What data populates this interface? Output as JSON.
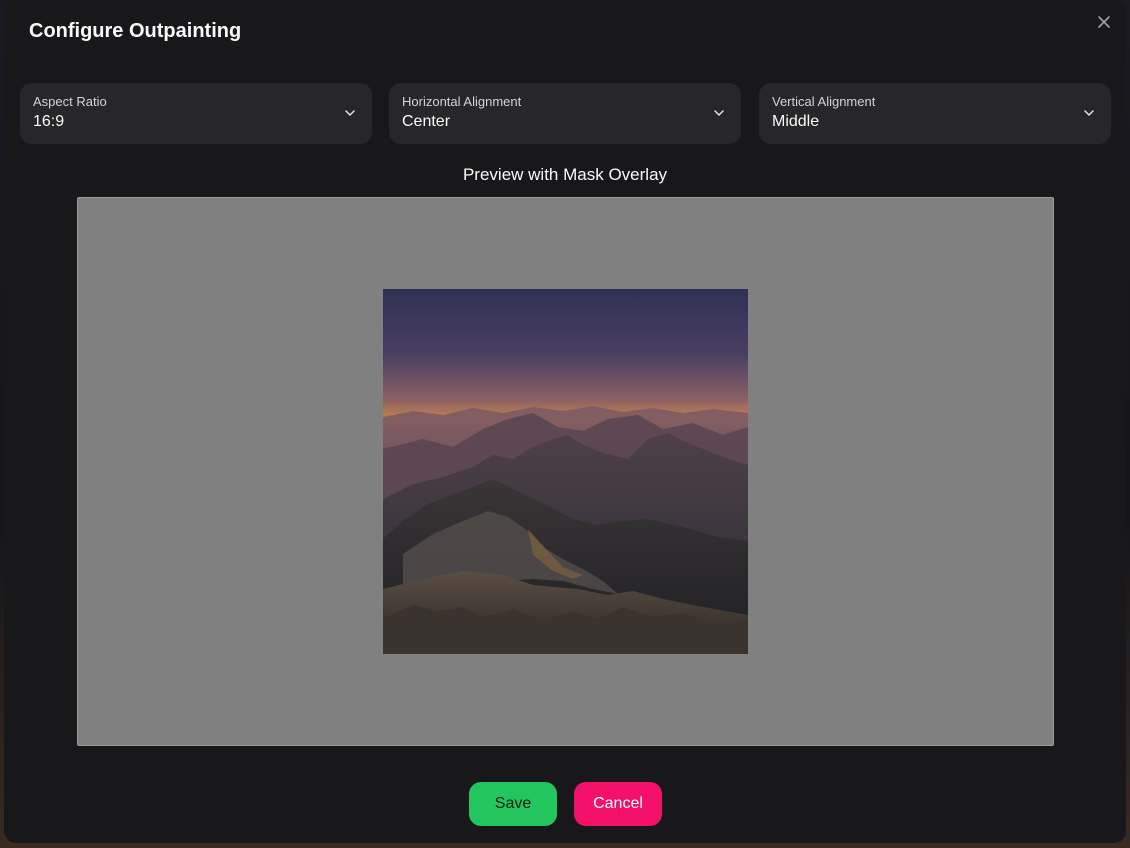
{
  "dialog": {
    "title": "Configure Outpainting"
  },
  "selects": [
    {
      "label": "Aspect Ratio",
      "value": "16:9"
    },
    {
      "label": "Horizontal Alignment",
      "value": "Center"
    },
    {
      "label": "Vertical Alignment",
      "value": "Middle"
    }
  ],
  "preview": {
    "title": "Preview with Mask Overlay"
  },
  "buttons": {
    "save_label": "Save",
    "cancel_label": "Cancel"
  },
  "colors": {
    "modal_bg": "#18181b",
    "select_bg": "#27272a",
    "mask_gray": "#808080",
    "save": "#22c55e",
    "cancel": "#f3116a"
  },
  "icons": {
    "close": "close-icon",
    "dropdown": "chevron-down-icon"
  }
}
